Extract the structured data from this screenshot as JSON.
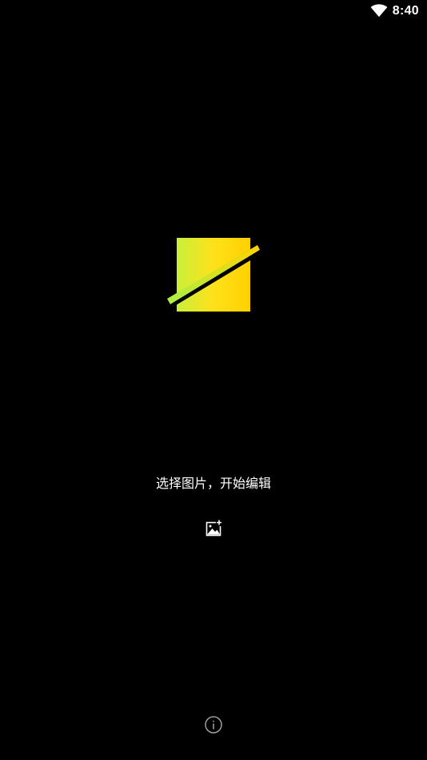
{
  "status_bar": {
    "time": "8:40",
    "wifi_icon": "wifi-icon"
  },
  "logo": {
    "icon": "app-logo-icon",
    "colors": {
      "gradient_start": "#b8f533",
      "gradient_end": "#ffd400",
      "stripe": "#000000"
    }
  },
  "main": {
    "prompt": "选择图片，开始编辑",
    "add_image_icon": "add-image-icon"
  },
  "footer": {
    "info_icon": "info-icon"
  }
}
